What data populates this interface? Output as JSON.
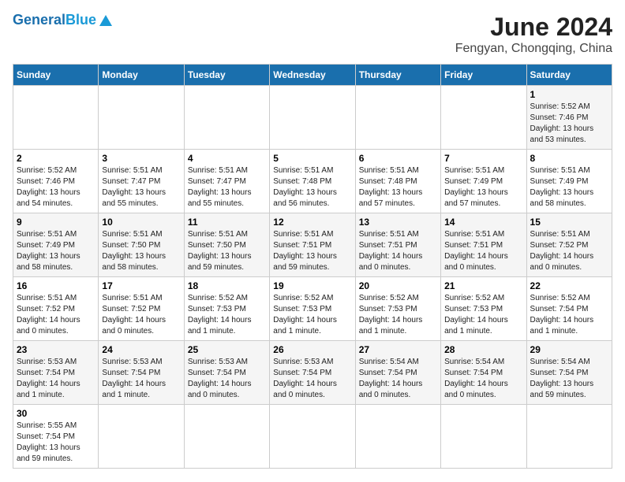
{
  "header": {
    "logo_general": "General",
    "logo_blue": "Blue",
    "title": "June 2024",
    "subtitle": "Fengyan, Chongqing, China"
  },
  "weekdays": [
    "Sunday",
    "Monday",
    "Tuesday",
    "Wednesday",
    "Thursday",
    "Friday",
    "Saturday"
  ],
  "weeks": [
    [
      {
        "day": "",
        "info": ""
      },
      {
        "day": "",
        "info": ""
      },
      {
        "day": "",
        "info": ""
      },
      {
        "day": "",
        "info": ""
      },
      {
        "day": "",
        "info": ""
      },
      {
        "day": "",
        "info": ""
      },
      {
        "day": "1",
        "info": "Sunrise: 5:52 AM\nSunset: 7:46 PM\nDaylight: 13 hours\nand 53 minutes."
      }
    ],
    [
      {
        "day": "2",
        "info": "Sunrise: 5:52 AM\nSunset: 7:46 PM\nDaylight: 13 hours\nand 54 minutes."
      },
      {
        "day": "3",
        "info": "Sunrise: 5:51 AM\nSunset: 7:47 PM\nDaylight: 13 hours\nand 55 minutes."
      },
      {
        "day": "4",
        "info": "Sunrise: 5:51 AM\nSunset: 7:47 PM\nDaylight: 13 hours\nand 55 minutes."
      },
      {
        "day": "5",
        "info": "Sunrise: 5:51 AM\nSunset: 7:48 PM\nDaylight: 13 hours\nand 56 minutes."
      },
      {
        "day": "6",
        "info": "Sunrise: 5:51 AM\nSunset: 7:48 PM\nDaylight: 13 hours\nand 57 minutes."
      },
      {
        "day": "7",
        "info": "Sunrise: 5:51 AM\nSunset: 7:49 PM\nDaylight: 13 hours\nand 57 minutes."
      },
      {
        "day": "8",
        "info": "Sunrise: 5:51 AM\nSunset: 7:49 PM\nDaylight: 13 hours\nand 58 minutes."
      }
    ],
    [
      {
        "day": "9",
        "info": "Sunrise: 5:51 AM\nSunset: 7:49 PM\nDaylight: 13 hours\nand 58 minutes."
      },
      {
        "day": "10",
        "info": "Sunrise: 5:51 AM\nSunset: 7:50 PM\nDaylight: 13 hours\nand 58 minutes."
      },
      {
        "day": "11",
        "info": "Sunrise: 5:51 AM\nSunset: 7:50 PM\nDaylight: 13 hours\nand 59 minutes."
      },
      {
        "day": "12",
        "info": "Sunrise: 5:51 AM\nSunset: 7:51 PM\nDaylight: 13 hours\nand 59 minutes."
      },
      {
        "day": "13",
        "info": "Sunrise: 5:51 AM\nSunset: 7:51 PM\nDaylight: 14 hours\nand 0 minutes."
      },
      {
        "day": "14",
        "info": "Sunrise: 5:51 AM\nSunset: 7:51 PM\nDaylight: 14 hours\nand 0 minutes."
      },
      {
        "day": "15",
        "info": "Sunrise: 5:51 AM\nSunset: 7:52 PM\nDaylight: 14 hours\nand 0 minutes."
      }
    ],
    [
      {
        "day": "16",
        "info": "Sunrise: 5:51 AM\nSunset: 7:52 PM\nDaylight: 14 hours\nand 0 minutes."
      },
      {
        "day": "17",
        "info": "Sunrise: 5:51 AM\nSunset: 7:52 PM\nDaylight: 14 hours\nand 0 minutes."
      },
      {
        "day": "18",
        "info": "Sunrise: 5:52 AM\nSunset: 7:53 PM\nDaylight: 14 hours\nand 1 minute."
      },
      {
        "day": "19",
        "info": "Sunrise: 5:52 AM\nSunset: 7:53 PM\nDaylight: 14 hours\nand 1 minute."
      },
      {
        "day": "20",
        "info": "Sunrise: 5:52 AM\nSunset: 7:53 PM\nDaylight: 14 hours\nand 1 minute."
      },
      {
        "day": "21",
        "info": "Sunrise: 5:52 AM\nSunset: 7:53 PM\nDaylight: 14 hours\nand 1 minute."
      },
      {
        "day": "22",
        "info": "Sunrise: 5:52 AM\nSunset: 7:54 PM\nDaylight: 14 hours\nand 1 minute."
      }
    ],
    [
      {
        "day": "23",
        "info": "Sunrise: 5:53 AM\nSunset: 7:54 PM\nDaylight: 14 hours\nand 1 minute."
      },
      {
        "day": "24",
        "info": "Sunrise: 5:53 AM\nSunset: 7:54 PM\nDaylight: 14 hours\nand 1 minute."
      },
      {
        "day": "25",
        "info": "Sunrise: 5:53 AM\nSunset: 7:54 PM\nDaylight: 14 hours\nand 0 minutes."
      },
      {
        "day": "26",
        "info": "Sunrise: 5:53 AM\nSunset: 7:54 PM\nDaylight: 14 hours\nand 0 minutes."
      },
      {
        "day": "27",
        "info": "Sunrise: 5:54 AM\nSunset: 7:54 PM\nDaylight: 14 hours\nand 0 minutes."
      },
      {
        "day": "28",
        "info": "Sunrise: 5:54 AM\nSunset: 7:54 PM\nDaylight: 14 hours\nand 0 minutes."
      },
      {
        "day": "29",
        "info": "Sunrise: 5:54 AM\nSunset: 7:54 PM\nDaylight: 13 hours\nand 59 minutes."
      }
    ],
    [
      {
        "day": "30",
        "info": "Sunrise: 5:55 AM\nSunset: 7:54 PM\nDaylight: 13 hours\nand 59 minutes."
      },
      {
        "day": "",
        "info": ""
      },
      {
        "day": "",
        "info": ""
      },
      {
        "day": "",
        "info": ""
      },
      {
        "day": "",
        "info": ""
      },
      {
        "day": "",
        "info": ""
      },
      {
        "day": "",
        "info": ""
      }
    ]
  ]
}
